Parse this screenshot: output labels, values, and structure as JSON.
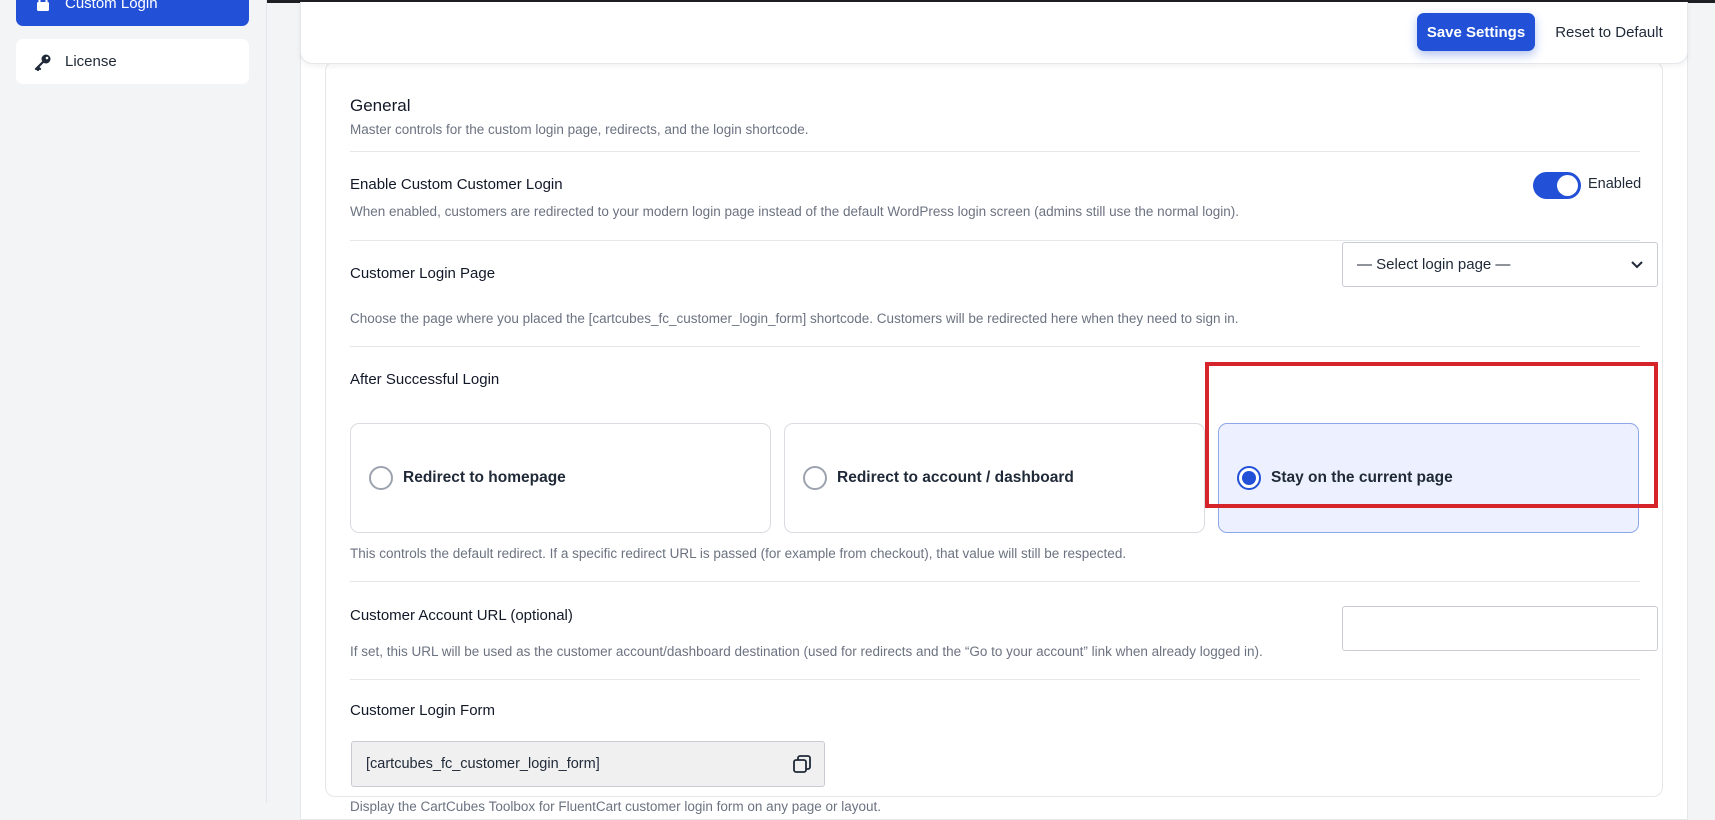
{
  "sidebar": {
    "items": [
      {
        "label": "Custom Login",
        "icon": "lock-icon",
        "active": true
      },
      {
        "label": "License",
        "icon": "key-icon",
        "active": false
      }
    ]
  },
  "toolbar": {
    "save_label": "Save Settings",
    "reset_label": "Reset to Default"
  },
  "general": {
    "title": "General",
    "description": "Master controls for the custom login page, redirects, and the login shortcode."
  },
  "enable_login": {
    "label": "Enable Custom Customer Login",
    "toggle_label": "Enabled",
    "description": "When enabled, customers are redirected to your modern login page instead of the default WordPress login screen (admins still use the normal login)."
  },
  "login_page": {
    "label": "Customer Login Page",
    "selected": "— Select login page —",
    "description": "Choose the page where you placed the [cartcubes_fc_customer_login_form] shortcode. Customers will be redirected here when they need to sign in."
  },
  "after_login": {
    "label": "After Successful Login",
    "options": [
      {
        "label": "Redirect to homepage",
        "selected": false
      },
      {
        "label": "Redirect to account / dashboard",
        "selected": false
      },
      {
        "label": "Stay on the current page",
        "selected": true
      }
    ],
    "description": "This controls the default redirect. If a specific redirect URL is passed (for example from checkout), that value will still be respected."
  },
  "account_url": {
    "label": "Customer Account URL (optional)",
    "value": "",
    "description": "If set, this URL will be used as the customer account/dashboard destination (used for redirects and the “Go to your account” link when already logged in)."
  },
  "login_form": {
    "label": "Customer Login Form",
    "shortcode": "[cartcubes_fc_customer_login_form]",
    "description": "Display the CartCubes Toolbox for FluentCart customer login form on any page or layout."
  },
  "colors": {
    "accent": "#2251d8",
    "highlight": "#d6242b"
  }
}
